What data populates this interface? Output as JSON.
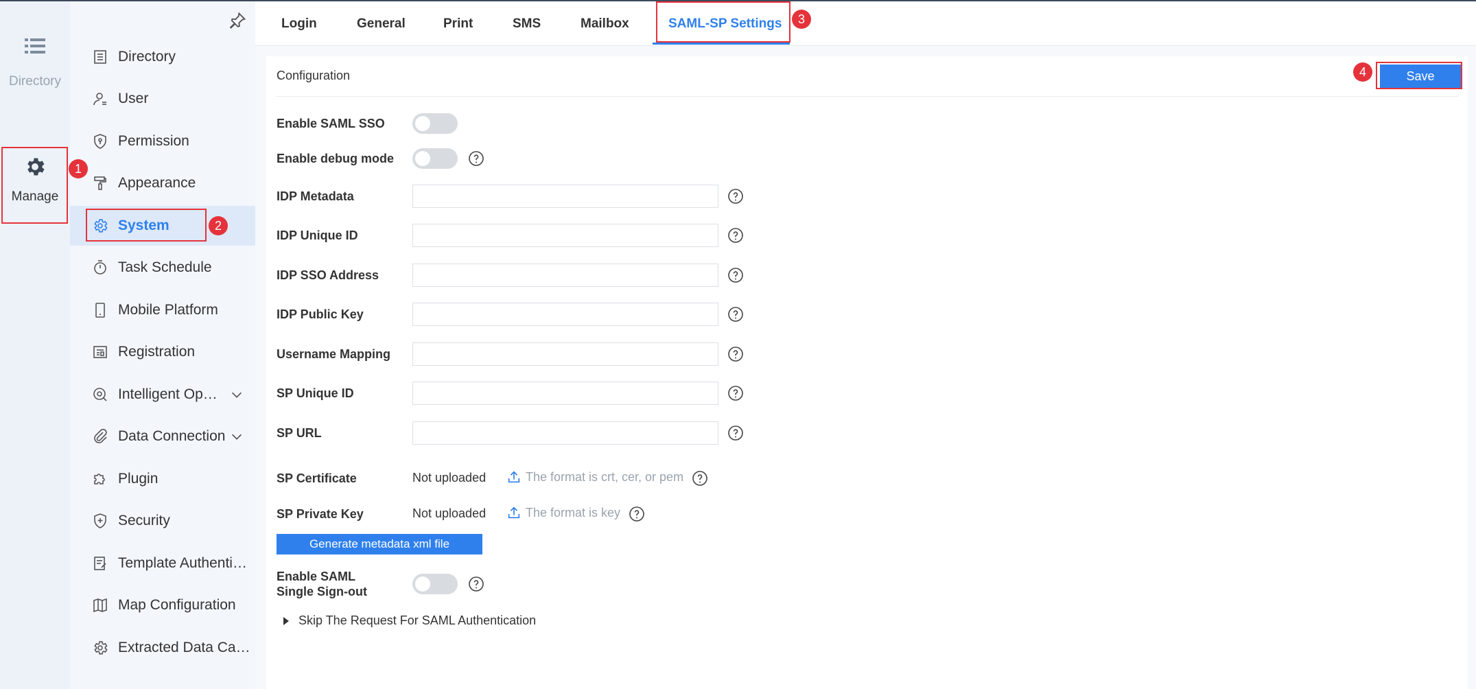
{
  "rail": {
    "items": [
      {
        "label": "Directory",
        "icon": "list-icon"
      },
      {
        "label": "Manage",
        "icon": "gear-icon"
      }
    ]
  },
  "sidebar": {
    "items": [
      {
        "label": "Directory",
        "icon": "document-list-icon"
      },
      {
        "label": "User",
        "icon": "user-icon"
      },
      {
        "label": "Permission",
        "icon": "shield-icon"
      },
      {
        "label": "Appearance",
        "icon": "paint-roller-icon"
      },
      {
        "label": "System",
        "icon": "gear-icon",
        "active": true
      },
      {
        "label": "Task Schedule",
        "icon": "stopwatch-icon"
      },
      {
        "label": "Mobile Platform",
        "icon": "mobile-icon"
      },
      {
        "label": "Registration",
        "icon": "registration-icon"
      },
      {
        "label": "Intelligent Ope…",
        "icon": "intelligent-ops-icon",
        "expandable": true
      },
      {
        "label": "Data Connection",
        "icon": "paperclip-icon",
        "expandable": true
      },
      {
        "label": "Plugin",
        "icon": "puzzle-icon"
      },
      {
        "label": "Security",
        "icon": "shield-plus-icon"
      },
      {
        "label": "Template Authentic…",
        "icon": "template-auth-icon"
      },
      {
        "label": "Map Configuration",
        "icon": "map-icon"
      },
      {
        "label": "Extracted Data Ca…",
        "icon": "gear-icon"
      }
    ]
  },
  "tabs": [
    {
      "label": "Login"
    },
    {
      "label": "General"
    },
    {
      "label": "Print"
    },
    {
      "label": "SMS"
    },
    {
      "label": "Mailbox"
    },
    {
      "label": "SAML-SP Settings",
      "active": true
    }
  ],
  "panel": {
    "title": "Configuration",
    "save_label": "Save"
  },
  "form": {
    "enable_saml_sso": {
      "label": "Enable SAML SSO",
      "on": false
    },
    "enable_debug": {
      "label": "Enable debug mode",
      "on": false
    },
    "idp_metadata": {
      "label": "IDP Metadata",
      "value": ""
    },
    "idp_unique_id": {
      "label": "IDP Unique ID",
      "value": ""
    },
    "idp_sso_address": {
      "label": "IDP SSO Address",
      "value": ""
    },
    "idp_public_key": {
      "label": "IDP Public Key",
      "value": ""
    },
    "username_mapping": {
      "label": "Username Mapping",
      "value": ""
    },
    "sp_unique_id": {
      "label": "SP Unique ID",
      "value": ""
    },
    "sp_url": {
      "label": "SP URL",
      "value": ""
    },
    "sp_certificate": {
      "label": "SP Certificate",
      "status": "Not uploaded",
      "hint": "The format is crt, cer, or pem"
    },
    "sp_private_key": {
      "label": "SP Private Key",
      "status": "Not uploaded",
      "hint": "The format is key"
    },
    "generate_label": "Generate metadata xml file",
    "single_signout": {
      "label_line1": "Enable SAML",
      "label_line2": "Single Sign-out",
      "on": false
    },
    "skip_request_label": "Skip The Request For SAML Authentication"
  },
  "annotations": [
    "1",
    "2",
    "3",
    "4"
  ],
  "colors": {
    "accent": "#2f80ed",
    "annotation": "#e5323b"
  }
}
